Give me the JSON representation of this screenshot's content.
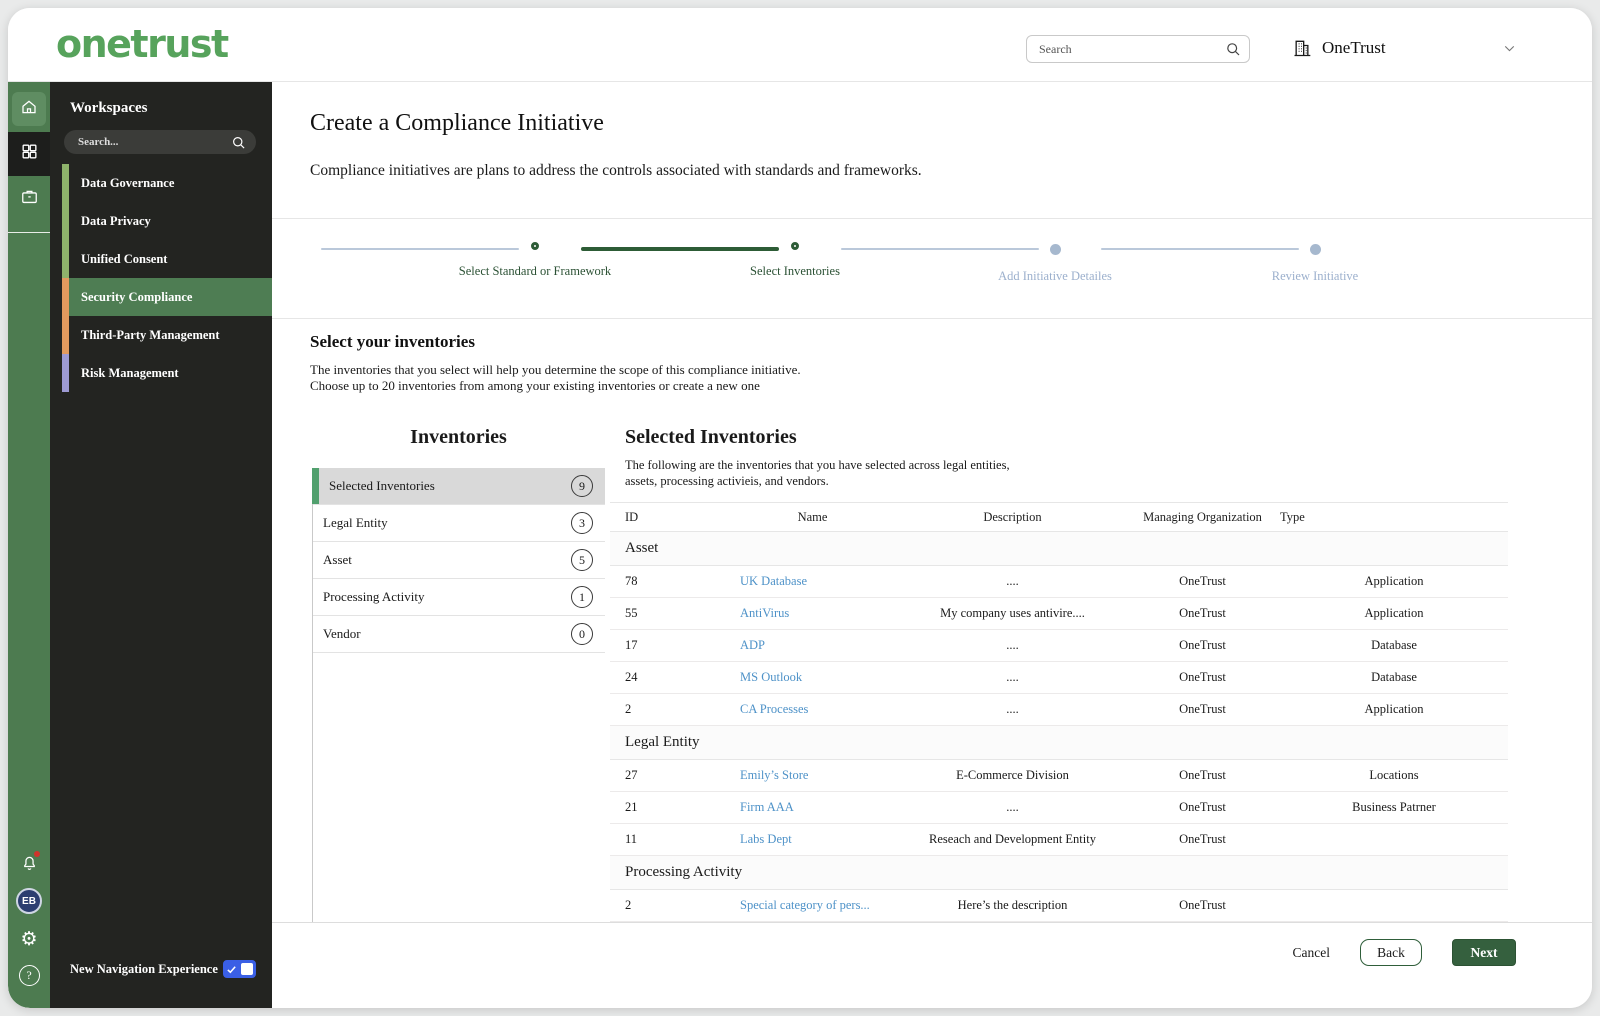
{
  "window": {
    "logo": "onetrust",
    "search_placeholder": "Search",
    "org_name": "OneTrust"
  },
  "icons": {
    "global_search": "magnifier",
    "org": "building",
    "org_expand": "chevron-down",
    "rail_top": [
      "home",
      "workspaces-grid",
      "briefcase"
    ],
    "rail_bottom": [
      "bell-notification",
      "avatar",
      "settings-gear",
      "help"
    ],
    "workspace_search": "magnifier"
  },
  "sidebar": {
    "workspaces_title": "Workspaces",
    "search_placeholder": "Search...",
    "items": [
      {
        "label": "Data Governance",
        "strip": "#8eb36b",
        "selected": false
      },
      {
        "label": "Data Privacy",
        "strip": "#8eb36b",
        "selected": false
      },
      {
        "label": "Unified Consent",
        "strip": "#8eb36b",
        "selected": false
      },
      {
        "label": "Security Compliance",
        "strip": "#e29a5e",
        "selected": true
      },
      {
        "label": "Third-Party Management",
        "strip": "#e29a5e",
        "selected": false
      },
      {
        "label": "Risk Management",
        "strip": "#9d9ad3",
        "selected": false
      }
    ],
    "avatar_initials": "EB",
    "footer": {
      "label": "New Navigation Experience",
      "toggle_on": true
    }
  },
  "page": {
    "title": "Create a Compliance Initiative",
    "subtitle": "Compliance initiatives are plans to address the controls associated with standards and frameworks."
  },
  "stepper": {
    "steps": [
      {
        "label": "Select Standard or Framework",
        "state": "complete"
      },
      {
        "label": "Select Inventories",
        "state": "current"
      },
      {
        "label": "Add Initiative Detailes",
        "state": "upcoming"
      },
      {
        "label": "Review Initiative",
        "state": "upcoming"
      }
    ]
  },
  "section": {
    "heading": "Select your inventories",
    "description_line1": "The inventories that you select will help you determine the scope of this compliance initiative.",
    "description_line2": "Choose up to 20 inventories from among your existing inventories or create a new one"
  },
  "inventories": {
    "heading": "Inventories",
    "categories": [
      {
        "label": "Selected Inventories",
        "count": "9",
        "selected": true
      },
      {
        "label": "Legal Entity",
        "count": "3",
        "selected": false
      },
      {
        "label": "Asset",
        "count": "5",
        "selected": false
      },
      {
        "label": "Processing Activity",
        "count": "1",
        "selected": false
      },
      {
        "label": "Vendor",
        "count": "0",
        "selected": false
      }
    ]
  },
  "selected_inventories": {
    "heading": "Selected Inventories",
    "description_line1": "The following are the inventories that you have selected across legal entities,",
    "description_line2": "assets, processing activieis, and vendors.",
    "table": {
      "columns": [
        "ID",
        "Name",
        "Description",
        "Managing Organization",
        "Type"
      ],
      "groups": [
        {
          "label": "Asset",
          "rows": [
            {
              "id": "78",
              "name": "UK Database",
              "description": "....",
              "org": "OneTrust",
              "type": "Application"
            },
            {
              "id": "55",
              "name": "AntiVirus",
              "description": "My company uses antivire....",
              "org": "OneTrust",
              "type": "Application"
            },
            {
              "id": "17",
              "name": "ADP",
              "description": "....",
              "org": "OneTrust",
              "type": "Database"
            },
            {
              "id": "24",
              "name": "MS Outlook",
              "description": "....",
              "org": "OneTrust",
              "type": "Database"
            },
            {
              "id": "2",
              "name": "CA Processes",
              "description": "....",
              "org": "OneTrust",
              "type": "Application"
            }
          ]
        },
        {
          "label": "Legal Entity",
          "rows": [
            {
              "id": "27",
              "name": "Emily’s Store",
              "description": "E-Commerce Division",
              "org": "OneTrust",
              "type": "Locations"
            },
            {
              "id": "21",
              "name": "Firm AAA",
              "description": "....",
              "org": "OneTrust",
              "type": "Business Patrner"
            },
            {
              "id": "11",
              "name": "Labs Dept",
              "description": "Reseach and Development Entity",
              "org": "OneTrust",
              "type": ""
            }
          ]
        },
        {
          "label": "Processing Activity",
          "rows": [
            {
              "id": "2",
              "name": "Special category of pers...",
              "description": "Here’s the description",
              "org": "OneTrust",
              "type": ""
            }
          ]
        }
      ]
    }
  },
  "footer": {
    "cancel_label": "Cancel",
    "back_label": "Back",
    "next_label": "Next"
  },
  "colors": {
    "brand_green": "#57a35c",
    "rail_green": "#4d7b50",
    "selected_workspace_green": "#4e7d53",
    "stepper_green": "#2d5c36",
    "stepper_inactive": "#a6b8ce",
    "link_blue": "#4e92c8",
    "toggle_blue": "#3a5fe5",
    "next_button_green": "#35603e",
    "selected_inventory_strip": "#51a06e"
  }
}
